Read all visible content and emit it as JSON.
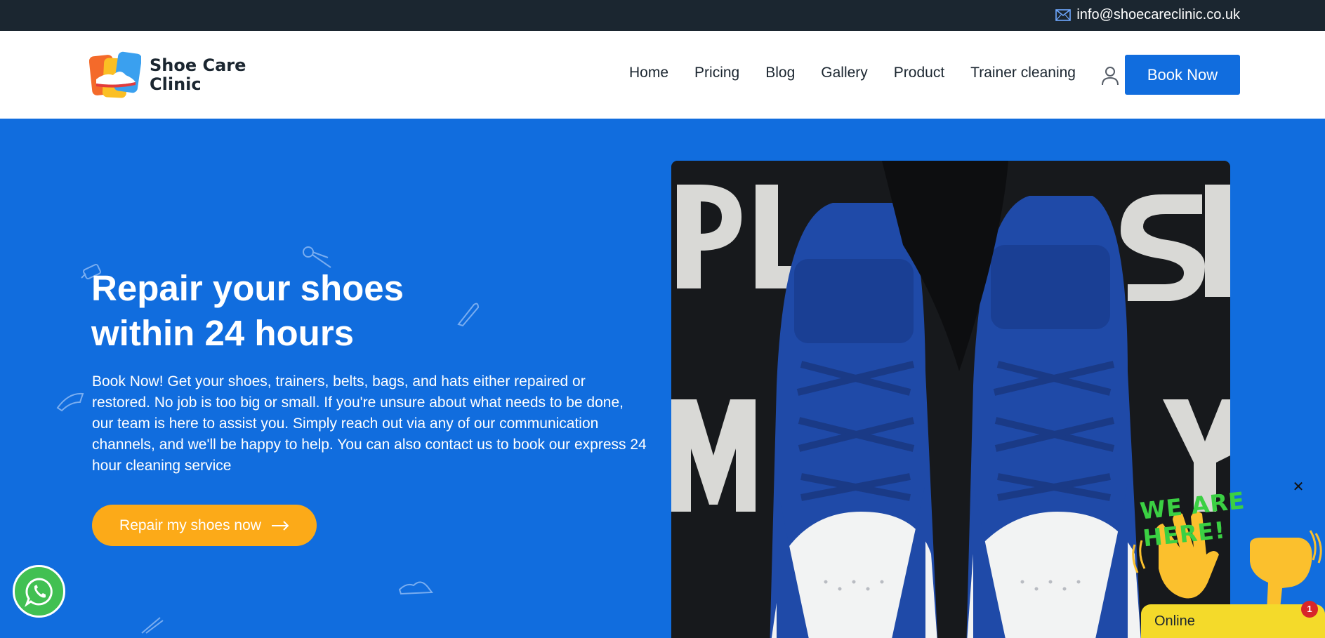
{
  "topbar": {
    "email": "info@shoecareclinic.co.uk",
    "email_icon": "mail-icon"
  },
  "header": {
    "logo": {
      "line1": "Shoe Care",
      "line2": "Clinic"
    },
    "nav": [
      {
        "label": "Home"
      },
      {
        "label": "Pricing"
      },
      {
        "label": "Blog"
      },
      {
        "label": "Gallery"
      },
      {
        "label": "Product"
      },
      {
        "label": "Trainer cleaning"
      }
    ],
    "account_icon": "user-icon",
    "book_label": "Book Now"
  },
  "hero": {
    "title_line1": "Repair your shoes",
    "title_line2": "within 24 hours",
    "text": "Book Now! Get your shoes, trainers, belts, bags, and hats either repaired or restored. No job is too big or small. If you're unsure about what needs to be done, our team is here to assist you. Simply reach out via any of our communication channels, and we'll be happy to help. You can also contact us to book our express 24 hour cleaning service",
    "cta_label": "Repair my shoes now",
    "cta_icon": "arrow-right-icon"
  },
  "widgets": {
    "whatsapp_icon": "whatsapp-icon",
    "chat_banner": "WE ARE HERE!",
    "chat_status": "Online",
    "chat_badge": "1",
    "chat_close": "✕"
  },
  "colors": {
    "primary": "#116dde",
    "topbar": "#1b2630",
    "cta": "#fcaa18",
    "whatsapp": "#41c052",
    "chat_bar": "#f4da2a",
    "chat_text": "#3bd043"
  }
}
